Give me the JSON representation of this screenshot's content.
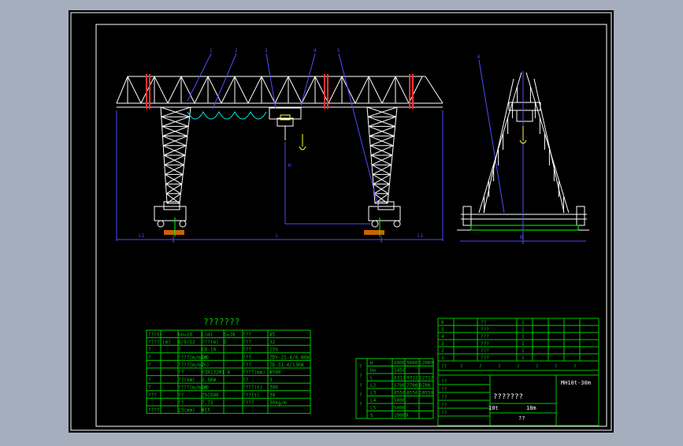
{
  "colors": {
    "background": "#a4aebd",
    "sheet": "#000000",
    "frame": "#ffffff",
    "structure": "#ffffff",
    "dimension": "#4d4dff",
    "table": "#00c800",
    "rail": "#ff3333",
    "rope": "#00e5e5",
    "accent": "#ffff33"
  },
  "drawing": {
    "title": "???????",
    "drawing_number": "MH10t-30m",
    "drawing_name": "???????",
    "scale_label": "10t",
    "span_label": "18m",
    "footer_label": "??",
    "dimension_labels": {
      "left_offset": "L1",
      "span": "L",
      "right_offset": "L1",
      "height": "H",
      "side_width": "B"
    },
    "balloons": [
      "1",
      "2",
      "3",
      "4",
      "5",
      "6"
    ]
  },
  "params_table": {
    "rows": [
      [
        "??(t)",
        "Gn=10",
        "L(m)",
        "S=18",
        "???",
        "A5"
      ],
      [
        "???? (m)",
        "6/9/12",
        "???(m)",
        "5",
        "???",
        "32"
      ],
      [
        "?",
        "?",
        "CD-10",
        "",
        "???",
        "25%"
      ],
      [
        "?",
        "????(m/min)",
        "20",
        "",
        "???",
        "ZDY-21-4/0.8KW"
      ],
      [
        "?",
        "????(m/min)",
        "7",
        "",
        "???",
        "ZD-51-4/13KW"
      ],
      [
        "",
        "??",
        "YZR132M1-6",
        "",
        "????(mm)",
        "Φ500"
      ],
      [
        "?",
        "??(kW)",
        "2.5KW",
        "",
        "??",
        "3"
      ],
      [
        "?",
        "????(m/min)",
        "20",
        "",
        "????(t)",
        "300"
      ],
      [
        "???",
        "??",
        "ZSC600",
        "",
        "???(t)",
        "30"
      ],
      [
        "",
        "??",
        "7.73",
        "",
        "????",
        "38kg/m"
      ],
      [
        "????",
        "13(mm)",
        "Φ15",
        "",
        "",
        ""
      ]
    ]
  },
  "dim_table": {
    "headers": [
      "H",
      "6000",
      "9000",
      "12000"
    ],
    "rows": [
      [
        "Ho",
        "1450",
        "",
        ""
      ],
      [
        "L",
        "6312",
        "9312",
        "12312"
      ],
      [
        "L2",
        "5700",
        "7700",
        "9700"
      ],
      [
        "L3",
        "6550",
        "8550",
        "10550"
      ],
      [
        "L4",
        "5000",
        "",
        ""
      ],
      [
        "L5",
        "5000",
        "",
        ""
      ],
      [
        "S",
        "19000",
        "",
        ""
      ]
    ],
    "side_labels": [
      "?",
      "?",
      "?",
      "?",
      "?"
    ]
  },
  "title_block": {
    "parts": [
      [
        "6",
        "",
        "??",
        "",
        "1",
        "",
        ""
      ],
      [
        "5",
        "",
        "???",
        "",
        "1",
        "",
        ""
      ],
      [
        "4",
        "",
        "???",
        "",
        "1",
        "",
        ""
      ],
      [
        "3",
        "",
        "???",
        "",
        "1",
        "",
        ""
      ],
      [
        "2",
        "",
        "???",
        "",
        "1",
        "",
        ""
      ],
      [
        "1",
        "",
        "???",
        "",
        "1",
        "",
        ""
      ]
    ],
    "header_row": [
      "??",
      "?",
      "?",
      "?",
      "?",
      "?",
      "?",
      "?"
    ],
    "sign_rows": [
      [
        "??"
      ],
      [
        "??"
      ],
      [
        "??"
      ],
      [
        "??"
      ],
      [
        "??"
      ]
    ]
  }
}
